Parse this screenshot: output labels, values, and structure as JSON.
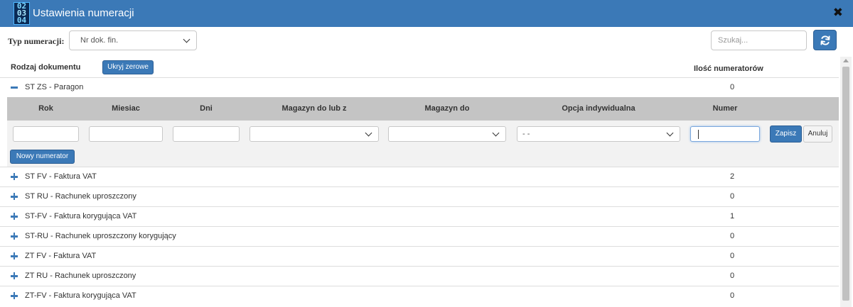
{
  "window": {
    "icon_digits": [
      "02",
      "03",
      "04"
    ],
    "title": "Ustawienia numeracji",
    "close_glyph": "✖"
  },
  "filter": {
    "label": "Typ numeracji:",
    "selected": "Nr dok. fin."
  },
  "search": {
    "placeholder": "Szukaj..."
  },
  "header": {
    "document_type": "Rodzaj dokumentu",
    "hide_zero_button": "Ukryj zerowe",
    "counter_count": "Ilość numeratorów"
  },
  "expanded_row": {
    "label": "ST ZS - Paragon",
    "count": "0"
  },
  "subtable": {
    "columns": [
      "Rok",
      "Miesiac",
      "Dni",
      "Magazyn do lub z",
      "Magazyn do",
      "Opcja indywidualna",
      "Numer"
    ],
    "individual_option_selected": "- -",
    "save_button": "Zapisz",
    "cancel_button": "Anuluj",
    "new_counter_button": "Nowy numerator"
  },
  "rows": [
    {
      "label": "ST FV - Faktura VAT",
      "count": "2"
    },
    {
      "label": "ST RU - Rachunek uproszczony",
      "count": "0"
    },
    {
      "label": "ST-FV - Faktura korygująca VAT",
      "count": "1"
    },
    {
      "label": "ST-RU - Rachunek uproszczony korygujący",
      "count": "0"
    },
    {
      "label": "ZT FV - Faktura VAT",
      "count": "0"
    },
    {
      "label": "ZT RU - Rachunek uproszczony",
      "count": "0"
    },
    {
      "label": "ZT-FV - Faktura korygująca VAT",
      "count": "0"
    }
  ],
  "colors": {
    "primary": "#3b79b7",
    "subtable_header": "#c4c4c4",
    "subtable_body": "#f2f2f2"
  }
}
